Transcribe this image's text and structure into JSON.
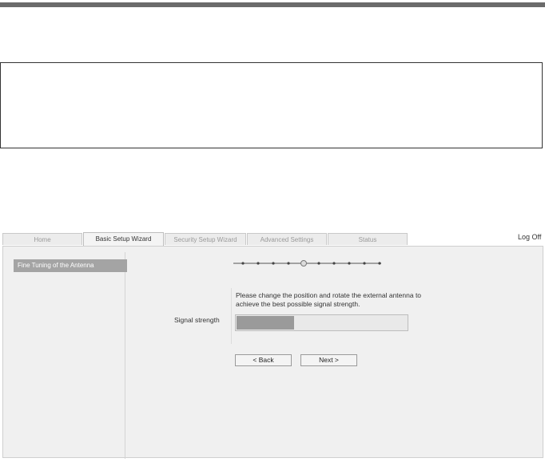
{
  "tabs": [
    {
      "label": "Home",
      "active": false
    },
    {
      "label": "Basic Setup Wizard",
      "active": true
    },
    {
      "label": "Security Setup Wizard",
      "active": false
    },
    {
      "label": "Advanced Settings",
      "active": false
    },
    {
      "label": "Status",
      "active": false
    }
  ],
  "header": {
    "logoff_label": "Log Off"
  },
  "sidebar": {
    "items": [
      {
        "label": "Fine Tuning of the Antenna",
        "active": true
      }
    ]
  },
  "wizard": {
    "total_steps": 10,
    "current_step": 4
  },
  "main": {
    "instruction_line1": "Please change the position and rotate the external antenna to",
    "instruction_line2": "achieve the best possible signal strength.",
    "signal_label": "Signal strength",
    "signal_level_percent": 34
  },
  "buttons": {
    "back_label": "< Back",
    "next_label": "Next >"
  },
  "colors": {
    "active_sidebar": "#a4a4a4",
    "panel_bg": "#f0f0f0",
    "signal_fill": "#9a9a9a"
  }
}
